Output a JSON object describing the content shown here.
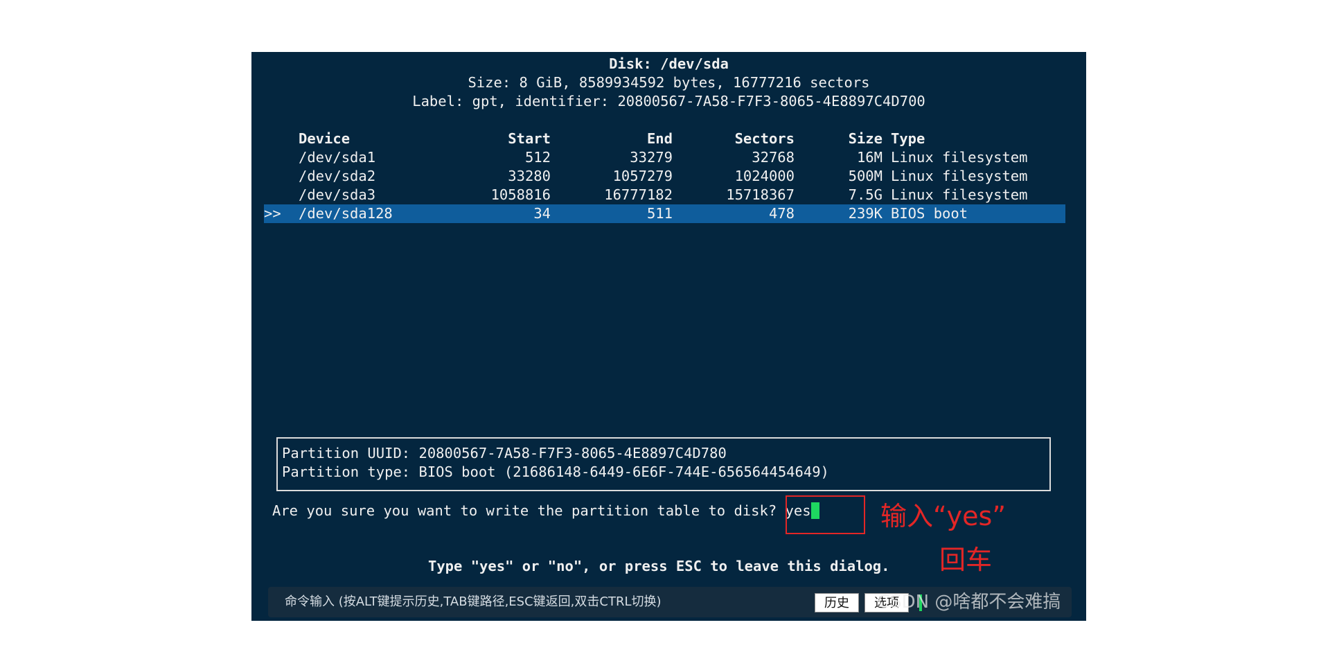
{
  "header": {
    "disk": "Disk: /dev/sda",
    "size": "Size: 8 GiB, 8589934592 bytes, 16777216 sectors",
    "label": "Label: gpt, identifier: 20800567-7A58-F7F3-8065-4E8897C4D700"
  },
  "table": {
    "columns": {
      "device": "Device",
      "start": "Start",
      "end": "End",
      "sectors": "Sectors",
      "size": "Size",
      "type": "Type"
    },
    "rows": [
      {
        "marker": "",
        "device": "/dev/sda1",
        "start": "512",
        "end": "33279",
        "sectors": "32768",
        "size": "16M",
        "type": "Linux filesystem"
      },
      {
        "marker": "",
        "device": "/dev/sda2",
        "start": "33280",
        "end": "1057279",
        "sectors": "1024000",
        "size": "500M",
        "type": "Linux filesystem"
      },
      {
        "marker": "",
        "device": "/dev/sda3",
        "start": "1058816",
        "end": "16777182",
        "sectors": "15718367",
        "size": "7.5G",
        "type": "Linux filesystem"
      },
      {
        "marker": ">>",
        "device": "/dev/sda128",
        "start": "34",
        "end": "511",
        "sectors": "478",
        "size": "239K",
        "type": "BIOS boot"
      }
    ]
  },
  "info": {
    "uuid": "Partition UUID: 20800567-7A58-F7F3-8065-4E8897C4D780",
    "type": "Partition type: BIOS boot (21686148-6449-6E6F-744E-656564454649)"
  },
  "prompt": {
    "question": "Are you sure you want to write the partition table to disk?",
    "input_value": "yes",
    "hint": "Type \"yes\" or \"no\", or press ESC to leave this dialog."
  },
  "annotations": {
    "type_yes": "输入“yes”",
    "enter": "回车"
  },
  "cmdbar": {
    "text": "命令输入 (按ALT键提示历史,TAB键路径,ESC键返回,双击CTRL切换)",
    "history_button": "历史",
    "options_button": "选项"
  },
  "watermark": "CSDN @啥都不会难搞",
  "colors": {
    "terminal_bg": "#04263f",
    "selection_bg": "#0f5d9c",
    "cursor": "#1ed760",
    "annotation": "#e32626"
  }
}
